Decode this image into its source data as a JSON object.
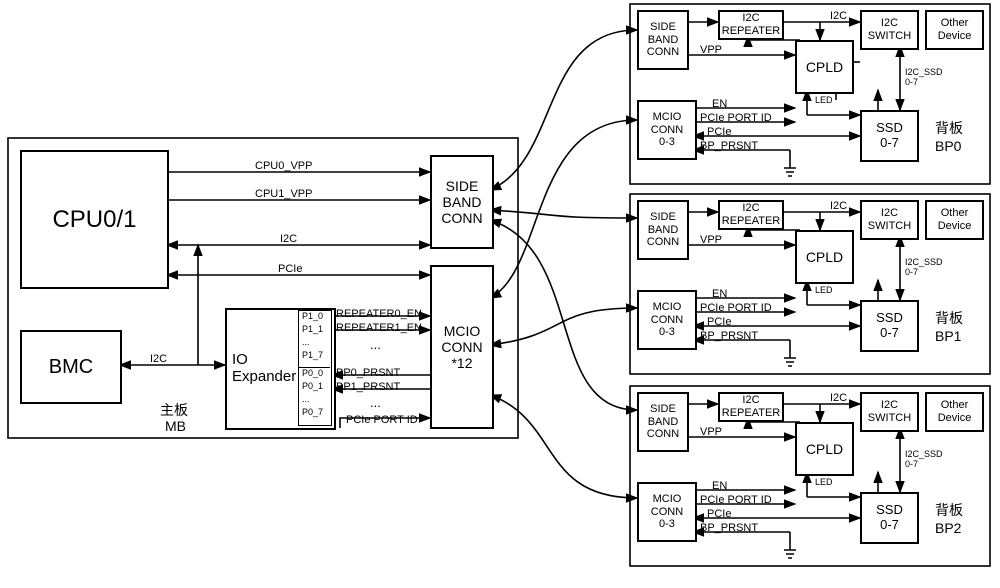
{
  "mainboard": {
    "cpu": "CPU0/1",
    "bmc": "BMC",
    "io_expander": "IO\nExpander",
    "io_ports_top": [
      "P1_0",
      "P1_1",
      "...",
      "P1_7"
    ],
    "io_ports_bot": [
      "P0_0",
      "P0_1",
      "...",
      "P0_7"
    ],
    "sideband": "SIDE\nBAND\nCONN",
    "mcio": "MCIO\nCONN\n*12",
    "label_zh": "主板",
    "label_en": "MB",
    "sig": {
      "cpu0_vpp": "CPU0_VPP",
      "cpu1_vpp": "CPU1_VPP",
      "i2c": "I2C",
      "pcie": "PCIe",
      "i2c_bmc": "I2C",
      "rep0_en": "REPEATER0_EN",
      "rep1_en": "REPEATER1_EN",
      "dots": "...",
      "bp0_prsnt": "BP0_PRSNT",
      "bp1_prsnt": "BP1_PRSNT",
      "dots2": "...",
      "pcie_port_id": "PCIe PORT ID"
    }
  },
  "backplane": {
    "sideband": "SIDE\nBAND\nCONN",
    "i2c_repeater": "I2C\nREPEATER",
    "cpld": "CPLD",
    "i2c_switch": "I2C\nSWITCH",
    "other_device": "Other\nDevice",
    "mcio": "MCIO\nCONN\n0-3",
    "ssd": "SSD\n0-7",
    "bp_label_zh": "背板",
    "bp_ids": [
      "BP0",
      "BP1",
      "BP2"
    ],
    "sig": {
      "i2c": "I2C",
      "vpp": "VPP",
      "en": "EN",
      "pcie_port_id": "PCIe PORT ID",
      "pcie": "PCIe",
      "bp_prsnt": "BP_PRSNT",
      "led": "LED",
      "i2c_ssd": "I2C_SSD\n0-7"
    }
  }
}
